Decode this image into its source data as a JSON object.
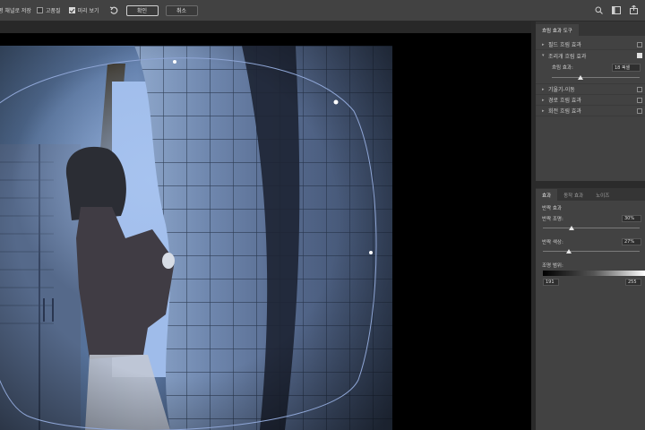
{
  "options_bar": {
    "save_channel_label": "평 채널로 저장",
    "high_quality_label": "고품질",
    "high_quality_checked": false,
    "preview_label": "미리 보기",
    "preview_checked": true,
    "ok_label": "확인",
    "cancel_label": "취소"
  },
  "blur_tools_panel": {
    "tab_label": "흐림 효과 도구",
    "items": [
      {
        "label": "필드 흐림 효과",
        "expanded": false,
        "checked": false
      },
      {
        "label": "조리개 흐림 효과",
        "expanded": true,
        "checked": true
      },
      {
        "label": "기울기-이동",
        "expanded": false,
        "checked": false
      },
      {
        "label": "경로 흐림 효과",
        "expanded": false,
        "checked": false
      },
      {
        "label": "회전 흐림 효과",
        "expanded": false,
        "checked": false
      }
    ],
    "blur_amount_label": "흐림 효과:",
    "blur_amount_value": "18 픽셀",
    "blur_amount_fraction": 0.33
  },
  "effects_panel": {
    "tabs": [
      "효과",
      "동작 효과",
      "노이즈"
    ],
    "bokeh_label": "반짝 효과",
    "light_bokeh_label": "반짝 조명:",
    "light_bokeh_value": "30%",
    "light_bokeh_fraction": 0.3,
    "bokeh_color_label": "반짝 색상:",
    "bokeh_color_value": "27%",
    "bokeh_color_fraction": 0.27,
    "light_range_label": "조명 범위:",
    "light_range_min": "191",
    "light_range_max": "255"
  },
  "icons": {
    "reset": "reset-icon",
    "search": "search-icon",
    "workspace": "workspace-icon",
    "share": "share-icon"
  },
  "colors": {
    "panel_bg": "#424242",
    "ellipse_stroke": "#8fa6d6"
  }
}
